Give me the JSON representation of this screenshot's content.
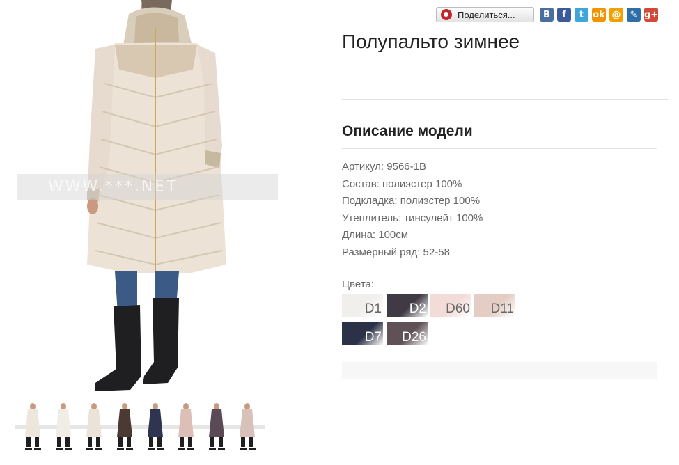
{
  "product": {
    "title": "Полупальто зимнее",
    "watermark": "WWW.***.NET"
  },
  "share": {
    "button_label": "Поделиться...",
    "services": [
      {
        "icon": "vk-icon",
        "glyph": "B",
        "color": "#4a6e9e"
      },
      {
        "icon": "facebook-icon",
        "glyph": "f",
        "color": "#3b5b9a"
      },
      {
        "icon": "twitter-icon",
        "glyph": "t",
        "color": "#3fa6dc"
      },
      {
        "icon": "odnoklassniki-icon",
        "glyph": "ok",
        "color": "#f29400"
      },
      {
        "icon": "mailru-icon",
        "glyph": "@",
        "color": "#f0a000"
      },
      {
        "icon": "livejournal-icon",
        "glyph": "✎",
        "color": "#2d6fa6"
      },
      {
        "icon": "google-plus-icon",
        "glyph": "g+",
        "color": "#d14a38"
      }
    ]
  },
  "description": {
    "heading": "Описание модели",
    "specs": [
      "Артикул: 9566-1B",
      "Состав: полиэстер 100%",
      "Подкладка: полиэстер 100%",
      "Утеплитель: тинсулейт 100%",
      "Длина: 100см",
      "Размерный ряд: 52-58"
    ]
  },
  "colors": {
    "label": "Цвета:",
    "items": [
      {
        "code": "D1",
        "color": "#f1efec",
        "light": true
      },
      {
        "code": "D2",
        "color": "#3f3a43",
        "light": false
      },
      {
        "code": "D60",
        "color": "#f1dcd8",
        "light": true
      },
      {
        "code": "D11",
        "color": "#e4cdc4",
        "light": true
      },
      {
        "code": "D7",
        "color": "#2b3146",
        "light": false
      },
      {
        "code": "D26",
        "color": "#5f5156",
        "light": false
      }
    ]
  },
  "thumbnails": [
    {
      "coat": "#ede6dc"
    },
    {
      "coat": "#f0ece6"
    },
    {
      "coat": "#ebe3d8"
    },
    {
      "coat": "#4a3a33"
    },
    {
      "coat": "#2f3550"
    },
    {
      "coat": "#dcbfb6"
    },
    {
      "coat": "#5a4a55"
    },
    {
      "coat": "#d9c1bb"
    }
  ]
}
